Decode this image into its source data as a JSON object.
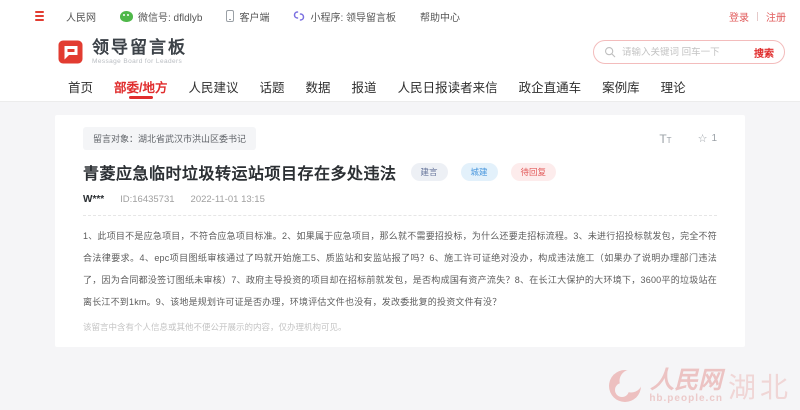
{
  "topbar": {
    "site": "人民网",
    "wechat": "微信号: dfldlyb",
    "client": "客户端",
    "miniprogram": "小程序: 领导留言板",
    "help": "帮助中心",
    "login": "登录",
    "register": "注册"
  },
  "brand": {
    "title": "领导留言板",
    "subtitle": "Message Board for Leaders"
  },
  "search": {
    "placeholder": "请输入关键词 回车一下",
    "button": "搜索"
  },
  "nav": {
    "items": [
      "首页",
      "部委/地方",
      "人民建议",
      "话题",
      "数据",
      "报道",
      "人民日报读者来信",
      "政企直通车",
      "案例库",
      "理论"
    ],
    "active": "部委/地方"
  },
  "message": {
    "target": "留言对象：湖北省武汉市洪山区委书记",
    "font_icon_large": "T",
    "font_icon_small": "T",
    "star_icon": "☆",
    "star_count": "1",
    "title": "青菱应急临时垃圾转运站项目存在多处违法",
    "tags": [
      {
        "label": "建言"
      },
      {
        "label": "城建"
      },
      {
        "label": "待回复"
      }
    ],
    "author": "W***",
    "user_id": "ID:16435731",
    "time": "2022-11-01 13:15",
    "body": "1、此项目不是应急项目，不符合应急项目标准。2、如果属于应急项目，那么就不需要招投标，为什么还要走招标流程。3、未进行招投标就发包，完全不符合法律要求。4、epc项目图纸审核通过了吗就开始施工5、质监站和安监站报了吗？6、施工许可证绝对没办，构成违法施工（如果办了说明办理部门违法了，因为合同都没签订图纸未审核）7、政府主导投资的项目却在招标前就发包，是否构成国有资产流失？8、在长江大保护的大环境下，3600平的垃圾站在离长江不到1km。9、该地是规划许可证是否办理，环境评估文件也没有，发改委批复的投资文件有没？",
    "footnote": "该留言中含有个人信息或其他不便公开展示的内容，仅办理机构可见。"
  },
  "watermark": {
    "name": "人民网",
    "url": "hb.people.cn",
    "region": "湖北"
  },
  "colors": {
    "accent": "#e02d2d",
    "tag_gray_text": "#66759b",
    "tag_blue_text": "#4a97dd",
    "tag_red_text": "#e25a5a"
  }
}
